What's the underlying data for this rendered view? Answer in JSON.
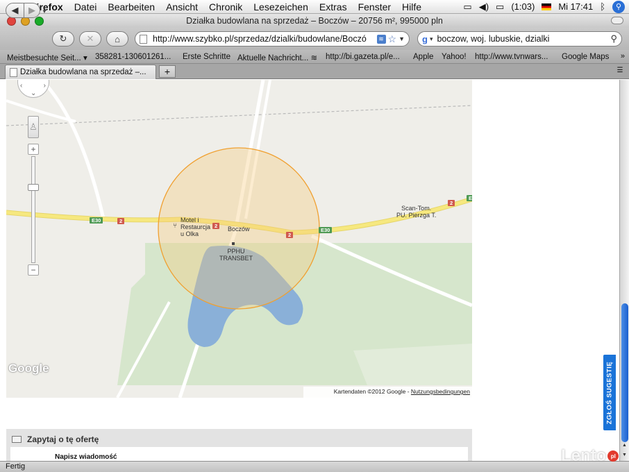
{
  "menubar": {
    "app": "Firefox",
    "items": [
      "Datei",
      "Bearbeiten",
      "Ansicht",
      "Chronik",
      "Lesezeichen",
      "Extras",
      "Fenster",
      "Hilfe"
    ],
    "battery": "(1:03)",
    "clock": "Mi 17:41"
  },
  "window": {
    "title": "Działka budowlana na sprzedaż – Boczów – 20756 m², 995000 pln"
  },
  "toolbar": {
    "url": "http://www.szybko.pl/sprzedaz/dzialki/budowlane/Boczó",
    "search_value": "boczow, woj. lubuskie, dzialki"
  },
  "bookmarks": [
    "Meistbesuchte Seit...",
    "358281-130601261...",
    "Erste Schritte",
    "Aktuelle Nachricht...",
    "http://bi.gazeta.pl/e...",
    "Apple",
    "Yahoo!",
    "http://www.tvnwars...",
    "Google Maps"
  ],
  "tabs": {
    "active_title": "Działka budowlana na sprzedaż –..."
  },
  "map": {
    "labels": {
      "motel": "Motel i\nRestaurcja\nu Olka",
      "village": "Boczów",
      "pphu": "PPHU\nTRANSBET",
      "scantom": "Scan-Tom.\nPU. Pierzga T."
    },
    "shields": {
      "e30": "E30",
      "road2": "2"
    },
    "logo": "Google",
    "credits_text": "Kartendaten ©2012 Google - ",
    "credits_link": "Nutzungsbedingungen",
    "colors": {
      "road": "#f6e87f",
      "circle_stroke": "#f0a030",
      "circle_fill": "#f5c878",
      "lake": "#8ab0d8",
      "forest": "#d6e6cc"
    }
  },
  "ask_panel": {
    "title": "Zapytaj o tę ofertę",
    "message_label": "Napisz wiadomość"
  },
  "feedback": {
    "label": "ZGŁOŚ SUGESTIĘ"
  },
  "status": {
    "text": "Fertig"
  },
  "watermark": {
    "text": "Lento",
    "badge": "pl"
  }
}
